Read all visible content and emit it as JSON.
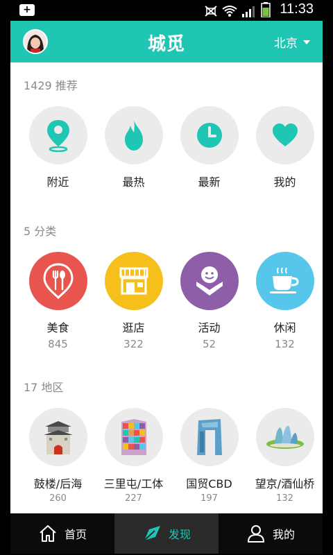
{
  "status": {
    "time": "11:33"
  },
  "header": {
    "title": "城觅",
    "city": "北京"
  },
  "recommend": {
    "title": "1429 推荐",
    "items": [
      {
        "label": "附近",
        "icon": "location-pin-icon"
      },
      {
        "label": "最热",
        "icon": "flame-icon"
      },
      {
        "label": "最新",
        "icon": "clock-icon"
      },
      {
        "label": "我的",
        "icon": "heart-icon"
      }
    ]
  },
  "categories": {
    "title": "5 分类",
    "items": [
      {
        "label": "美食",
        "count": "845",
        "color": "#e8554e",
        "icon": "fork-spoon-icon"
      },
      {
        "label": "逛店",
        "count": "322",
        "color": "#f5c01b",
        "icon": "storefront-icon"
      },
      {
        "label": "活动",
        "count": "52",
        "color": "#8e5fa8",
        "icon": "smiley-person-icon"
      },
      {
        "label": "休闲",
        "count": "132",
        "color": "#56c6ea",
        "icon": "coffee-cup-icon"
      }
    ]
  },
  "areas": {
    "title": "17 地区",
    "items": [
      {
        "label": "鼓楼/后海",
        "count": "260",
        "icon": "drum-tower-icon"
      },
      {
        "label": "三里屯/工体",
        "count": "227",
        "icon": "colorful-building-icon"
      },
      {
        "label": "国贸CBD",
        "count": "197",
        "icon": "cctv-tower-icon"
      },
      {
        "label": "望京/酒仙桥",
        "count": "132",
        "icon": "wangjing-soho-icon"
      }
    ]
  },
  "nav": {
    "home": "首页",
    "discover": "发现",
    "mine": "我的"
  },
  "colors": {
    "accent": "#1ec6b3"
  }
}
